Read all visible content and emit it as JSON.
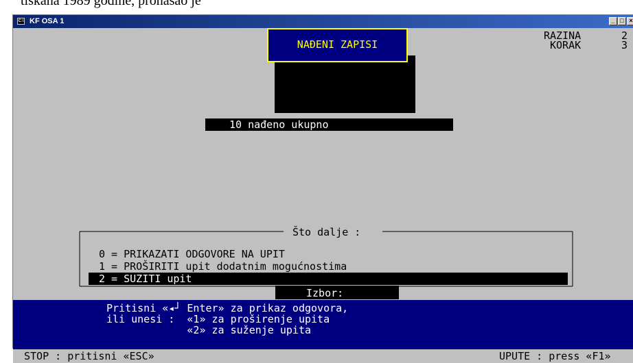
{
  "document_text": "tiskana 1989 godine, pronašao je",
  "window": {
    "title": "KF OSA 1",
    "icon": "console-icon"
  },
  "found_box": {
    "label": "NAĐENI ZAPISI"
  },
  "info": {
    "razina_label": "RAZINA",
    "razina_value": "2",
    "korak_label": "KORAK",
    "korak_value": "3"
  },
  "result": {
    "count_text": "10 nađeno ukupno"
  },
  "menu": {
    "title": "Što dalje :",
    "items": [
      {
        "text": "0 = PRIKAZATI ODGOVORE NA UPIT"
      },
      {
        "text": "1 = PROŠIRITI upit dodatnim mogućnostima"
      },
      {
        "text": "2 = SUZITI upit"
      }
    ],
    "selected_index": 2,
    "prompt": "Izbor:"
  },
  "instructions": {
    "line1": "Pritisni «◂┘ Enter» za prikaz odgovora,",
    "line2": "ili unesi :  «1» za proširenje upita",
    "line3": "             «2» za suženje upita"
  },
  "status": {
    "stop": "STOP : pritisni «ESC»",
    "help": "UPUTE : press «F1»"
  }
}
